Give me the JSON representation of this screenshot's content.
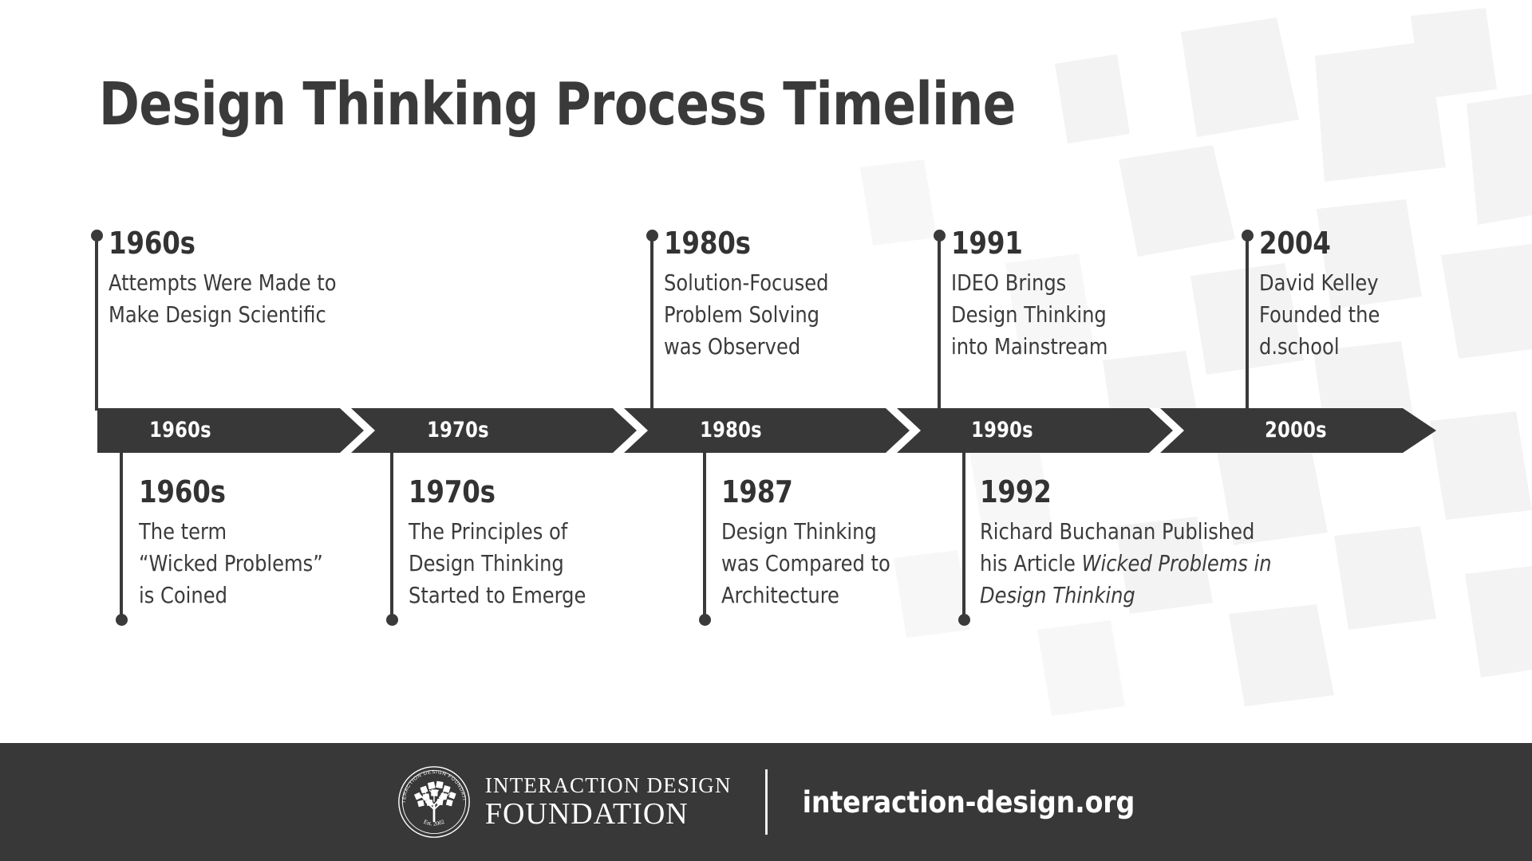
{
  "page": {
    "title": "Design Thinking Process Timeline",
    "background_color": "#ffffff",
    "ink_color": "#3a3a3a",
    "bar_color": "#383838"
  },
  "timeline": {
    "segments": [
      {
        "label": "1960s"
      },
      {
        "label": "1970s"
      },
      {
        "label": "1980s"
      },
      {
        "label": "1990s"
      },
      {
        "label": "2000s"
      }
    ],
    "above_events": [
      {
        "year": "1960s",
        "description": "Attempts Were Made to Make Design Scientific",
        "lines": [
          "Attempts Were Made to",
          "Make Design Scientific"
        ]
      },
      {
        "year": "1980s",
        "description": "Solution-Focused Problem Solving was Observed",
        "lines": [
          "Solution-Focused",
          "Problem Solving",
          "was Observed"
        ]
      },
      {
        "year": "1991",
        "description": "IDEO Brings Design Thinking into Mainstream",
        "lines": [
          "IDEO Brings",
          "Design Thinking",
          "into Mainstream"
        ]
      },
      {
        "year": "2004",
        "description": "David Kelley Founded the d.school",
        "lines": [
          "David Kelley",
          "Founded the",
          "d.school"
        ]
      }
    ],
    "below_events": [
      {
        "year": "1960s",
        "description": "The term “Wicked Problems” is Coined",
        "lines": [
          "The term",
          "“Wicked Problems”",
          "is Coined"
        ]
      },
      {
        "year": "1970s",
        "description": "The Principles of Design Thinking Started to Emerge",
        "lines": [
          "The Principles of",
          "Design Thinking",
          "Started to Emerge"
        ]
      },
      {
        "year": "1987",
        "description": "Design Thinking was Compared to Architecture",
        "lines": [
          "Design Thinking",
          "was Compared to",
          "Architecture"
        ]
      },
      {
        "year": "1992",
        "description": "Richard Buchanan Published his Article Wicked Problems in Design Thinking",
        "lines": [
          "Richard Buchanan Published",
          "his Article ",
          "Design Thinking"
        ],
        "italic_title": "Wicked Problems in"
      }
    ]
  },
  "footer": {
    "logo": {
      "ring_text": "INTERACTION DESIGN FOUNDATION",
      "established": "Est. 2002",
      "icon": "tree-seal-logo"
    },
    "wordmark_line1": "INTERACTION DESIGN",
    "wordmark_line2": "FOUNDATION",
    "url": "interaction-design.org",
    "background_color": "#383838"
  }
}
